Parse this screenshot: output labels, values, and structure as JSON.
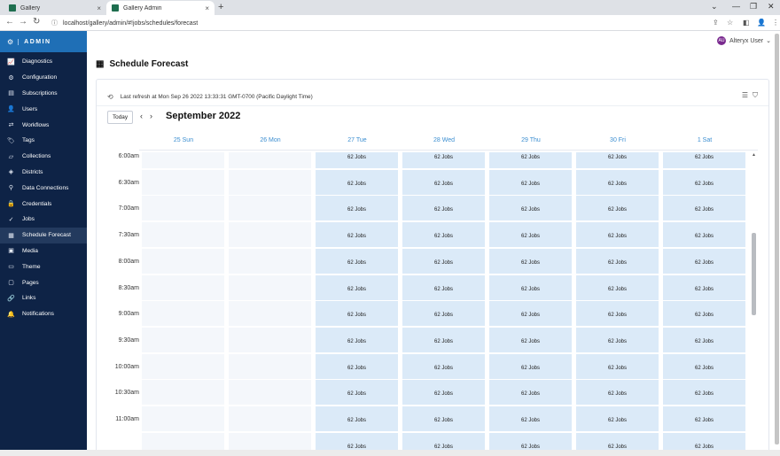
{
  "browser": {
    "tabs": [
      {
        "title": "Gallery",
        "close": "×"
      },
      {
        "title": "Gallery Admin",
        "close": "×"
      }
    ],
    "new_tab": "+",
    "window_controls": [
      "⌄",
      "—",
      "❐",
      "✕"
    ],
    "url": "localhost/gallery/admin/#!jobs/schedules/forecast",
    "nav": {
      "back": "←",
      "forward": "→",
      "reload": "↻",
      "info": "ⓘ"
    },
    "toolbar_icons": [
      "⇪",
      "☆",
      "◧",
      "👤",
      "⋮"
    ]
  },
  "sidebar": {
    "brand": "ADMIN",
    "brand_icon": "⚙",
    "items": [
      {
        "label": "Diagnostics",
        "icon": "📈",
        "icon_name": "diagnostics-icon"
      },
      {
        "label": "Configuration",
        "icon": "⚙",
        "icon_name": "gear-icon"
      },
      {
        "label": "Subscriptions",
        "icon": "▤",
        "icon_name": "subscriptions-icon"
      },
      {
        "label": "Users",
        "icon": "👤",
        "icon_name": "user-icon"
      },
      {
        "label": "Workflows",
        "icon": "⇄",
        "icon_name": "workflows-icon"
      },
      {
        "label": "Tags",
        "icon": "🏷",
        "icon_name": "tag-icon"
      },
      {
        "label": "Collections",
        "icon": "▱",
        "icon_name": "collections-icon"
      },
      {
        "label": "Districts",
        "icon": "◈",
        "icon_name": "districts-icon"
      },
      {
        "label": "Data Connections",
        "icon": "⚲",
        "icon_name": "data-connections-icon"
      },
      {
        "label": "Credentials",
        "icon": "🔒",
        "icon_name": "credentials-icon"
      },
      {
        "label": "Jobs",
        "icon": "✓",
        "icon_name": "jobs-icon"
      },
      {
        "label": "Schedule Forecast",
        "icon": "▦",
        "icon_name": "calendar-icon"
      },
      {
        "label": "Media",
        "icon": "▣",
        "icon_name": "media-icon"
      },
      {
        "label": "Theme",
        "icon": "▭",
        "icon_name": "theme-icon"
      },
      {
        "label": "Pages",
        "icon": "▢",
        "icon_name": "pages-icon"
      },
      {
        "label": "Links",
        "icon": "🔗",
        "icon_name": "link-icon"
      },
      {
        "label": "Notifications",
        "icon": "🔔",
        "icon_name": "bell-icon"
      }
    ],
    "active_index": 11
  },
  "user": {
    "initials": "AU",
    "name": "Alteryx User",
    "chevron": "⌄"
  },
  "page": {
    "title": "Schedule Forecast",
    "title_icon": "▦"
  },
  "toolbar": {
    "refresh_icon": "⟲",
    "last_refresh": "Last refresh at Mon Sep 26 2022 13:33:31 GMT-0700 (Pacific Daylight Time)",
    "list_icon": "☰",
    "filter_icon": "⛉"
  },
  "calendar": {
    "today_label": "Today",
    "prev": "‹",
    "next": "›",
    "month": "September 2022",
    "days": [
      "25 Sun",
      "26 Mon",
      "27 Tue",
      "28 Wed",
      "29 Thu",
      "30 Fri",
      "1 Sat"
    ],
    "times": [
      "6:00am",
      "6:30am",
      "7:00am",
      "7:30am",
      "8:00am",
      "8:30am",
      "9:00am",
      "9:30am",
      "10:00am",
      "10:30am",
      "11:00am",
      ""
    ],
    "job_label": "62 Jobs",
    "job_day_indices": [
      2,
      3,
      4,
      5,
      6
    ],
    "scroll_up": "▲",
    "scroll_fraction": 0.29
  }
}
